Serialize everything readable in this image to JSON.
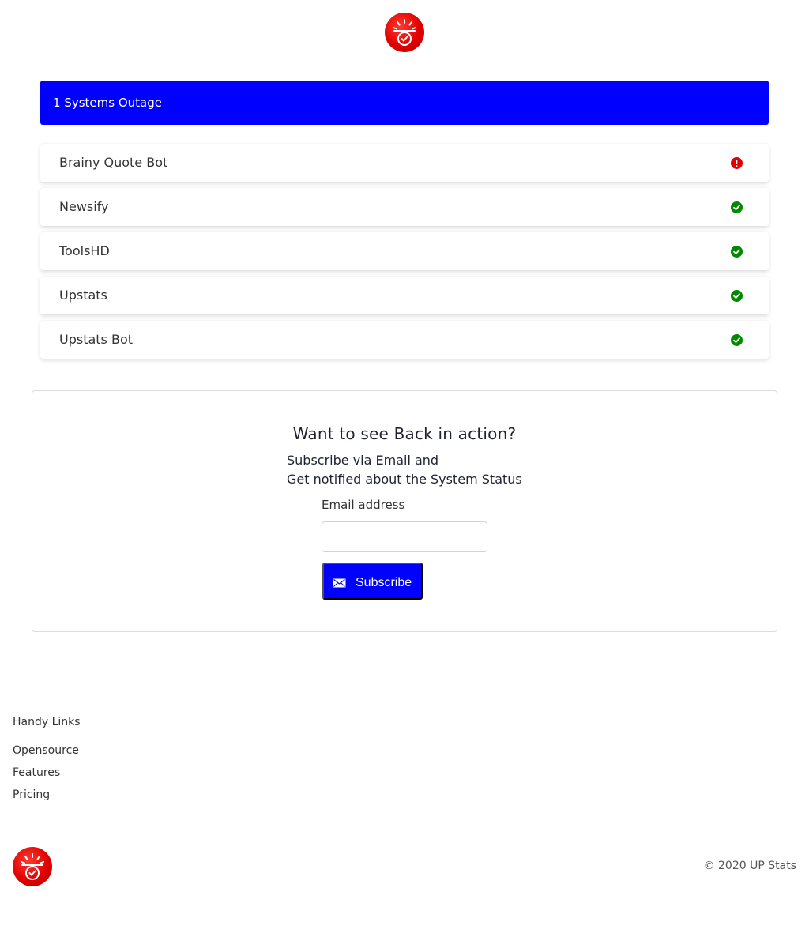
{
  "logo_icon": "alarm-clock-check-icon",
  "banner": {
    "text": "1 Systems Outage",
    "color": "#0000ff"
  },
  "systems": [
    {
      "name": "Brainy Quote Bot",
      "status": "down",
      "icon": "exclamation-circle-icon",
      "color": "#e00000"
    },
    {
      "name": "Newsify",
      "status": "up",
      "icon": "check-circle-icon",
      "color": "#008a00"
    },
    {
      "name": "ToolsHD",
      "status": "up",
      "icon": "check-circle-icon",
      "color": "#008a00"
    },
    {
      "name": "Upstats",
      "status": "up",
      "icon": "check-circle-icon",
      "color": "#008a00"
    },
    {
      "name": "Upstats Bot",
      "status": "up",
      "icon": "check-circle-icon",
      "color": "#008a00"
    }
  ],
  "subscribe": {
    "heading": "Want to see Back in action?",
    "line1": "Subscribe via Email and",
    "line2": "Get notified about the System Status",
    "email_label": "Email address",
    "email_value": "",
    "button_label": "Subscribe",
    "button_icon": "envelope-icon"
  },
  "footer": {
    "heading": "Handy Links",
    "links": [
      "Opensource",
      "Features",
      "Pricing"
    ],
    "copyright": "© 2020 UP Stats"
  }
}
